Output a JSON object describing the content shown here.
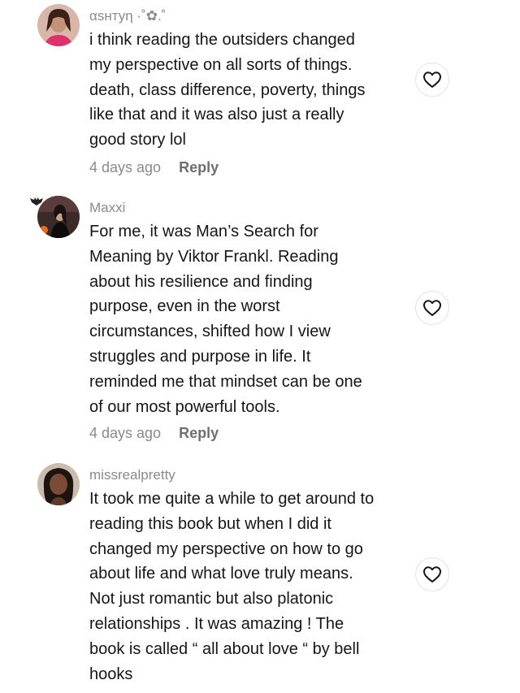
{
  "comments": [
    {
      "username": "αsнтуη ·˚✿.˚",
      "text": "i think reading the outsiders changed\nmy perspective on all sorts of things.\ndeath, class difference, poverty, things\nlike that and it was also just a really\ngood story lol",
      "time": "4 days ago",
      "reply": "Reply",
      "avatar_icon": "profile-photo"
    },
    {
      "username": "Maxxi",
      "text": "For me, it was Man’s Search for\nMeaning by Viktor Frankl. Reading\nabout his resilience and finding\npurpose, even in the worst\ncircumstances, shifted how I view\nstruggles and purpose in life. It\nreminded me that mindset can be one\nof our most powerful tools.",
      "time": "4 days ago",
      "reply": "Reply",
      "avatar_icon": "profile-photo"
    },
    {
      "username": "missrealpretty",
      "text": "It took me quite a while to get around to\nreading this book but when I did it\nchanged my perspective on how to go\nabout life and what love truly means.\nNot just romantic but also platonic\nrelationships . It was amazing ! The\nbook is called “ all about love “ by bell\nhooks",
      "avatar_icon": "profile-photo"
    }
  ],
  "like_icon": "heart-outline-icon",
  "colors": {
    "text": "#161616",
    "muted": "#8a8a8a",
    "reply": "#6f6f6f"
  }
}
